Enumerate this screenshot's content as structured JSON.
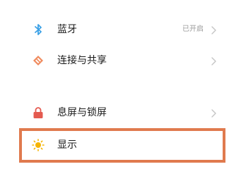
{
  "settings": {
    "items": [
      {
        "label": "蓝牙",
        "status": "已开启",
        "icon": "bluetooth-icon",
        "icon_color": "#3aa0e6"
      },
      {
        "label": "连接与共享",
        "status": "",
        "icon": "connection-share-icon",
        "icon_color": "#e47a4f"
      },
      {
        "label": "息屏与锁屏",
        "status": "",
        "icon": "lock-icon",
        "icon_color": "#e45a4f"
      },
      {
        "label": "显示",
        "status": "",
        "icon": "sun-icon",
        "icon_color": "#f5b400"
      }
    ]
  },
  "colors": {
    "highlight": "#e07a4e",
    "chevron": "#c4c4c4",
    "status_text": "#9a9a9a"
  }
}
